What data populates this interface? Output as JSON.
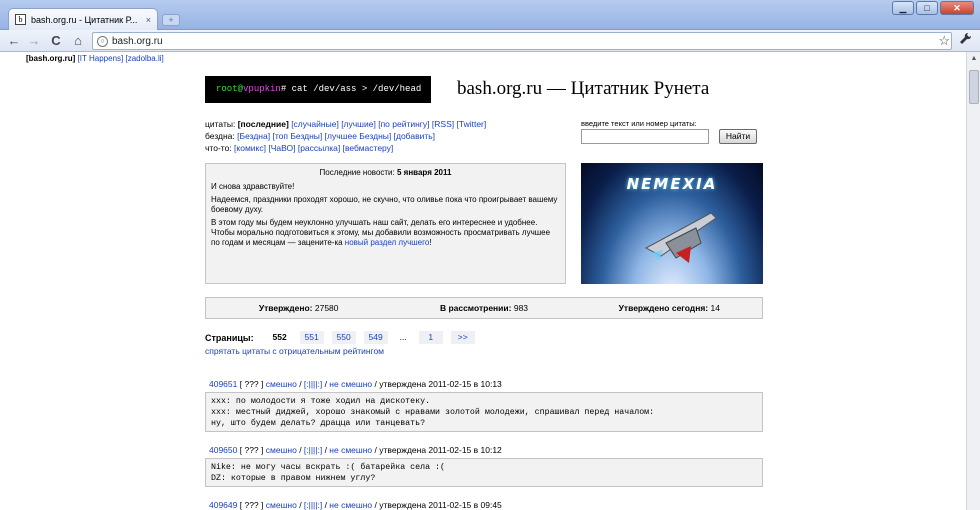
{
  "browser": {
    "tab_title": "bash.org.ru - Цитатник Р...",
    "tab_close": "×",
    "new_tab": "+",
    "url": "bash.org.ru",
    "win_min": "▁",
    "win_max": "□",
    "win_close": "✕",
    "back": "←",
    "forward": "→",
    "reload": "C",
    "home": "⌂",
    "star": "☆",
    "wrench": "🔧"
  },
  "bookmarks": {
    "current": "[bash.org.ru]",
    "it_happens": "[IT Happens]",
    "zadolba": "[zadolba.li]"
  },
  "header": {
    "prompt_user": "root",
    "prompt_at": "@",
    "prompt_host": "vpupkin",
    "prompt_cmd": "# cat /dev/ass > /dev/head",
    "site_title": "bash.org.ru — Цитатник Рунета"
  },
  "nav": {
    "quotes_label": "цитаты:",
    "quotes_current": "[последние]",
    "quotes_links": [
      "[случайные]",
      "[лучшие]",
      "[по рейтингу]",
      "[RSS]",
      "[Twitter]"
    ],
    "abyss_label": "бездна:",
    "abyss_links": [
      "[Бездна]",
      "[топ Бездны]",
      "[лучшее Бездны]",
      "[добавить]"
    ],
    "other_label": "что-то:",
    "other_links": [
      "[комикс]",
      "[ЧаВО]",
      "[рассылка]",
      "[вебмастеру]"
    ]
  },
  "search": {
    "label": "введите текст или номер цитаты:",
    "value": "",
    "button": "Найти"
  },
  "news": {
    "heading_prefix": "Последние новости:",
    "heading_date": "5 января 2011",
    "p1": "И снова здравствуйте!",
    "p2": "Надеемся, праздники проходят хорошо, не скучно, что оливье пока что проигрывает вашему боевому духу.",
    "p3": "В этом году мы будем неуклонно улучшать наш сайт, делать его интереснее и удобнее. Чтобы морально подготовиться к этому, мы добавили возможность просматривать лучшее по годам и месяцам — зацените-ка ",
    "p3_link": "новый раздел лучшего",
    "p3_end": "!"
  },
  "banner": {
    "title": "NEMEXIA"
  },
  "stats": {
    "approved_label": "Утверждено:",
    "approved_value": "27580",
    "review_label": "В рассмотрении:",
    "review_value": "983",
    "today_label": "Утверждено сегодня:",
    "today_value": "14"
  },
  "pager": {
    "label": "Страницы:",
    "current": "552",
    "pages": [
      "551",
      "550",
      "549"
    ],
    "dots": "...",
    "first": "1",
    "next": ">>",
    "hide_negative": "спрятать цитаты с отрицательным рейтингом"
  },
  "quotes": [
    {
      "id": "409651",
      "rating": "[ ??? ]",
      "funny": "смешно",
      "bayan": "[:||||:]",
      "not_funny": "не смешно",
      "approved": "/ утверждена 2011-02-15 в 10:13",
      "text": "xxx: по молодости я тоже ходил на дискотеку.\nxxx: местный диджей, хорошо знакомый с нравами золотой молодежи, спрашивал перед началом:\nну, што будем делать? драцца или танцевать?"
    },
    {
      "id": "409650",
      "rating": "[ ??? ]",
      "funny": "смешно",
      "bayan": "[:||||:]",
      "not_funny": "не смешно",
      "approved": "/ утверждена 2011-02-15 в 10:12",
      "text": "Nike: не могу часы вскрать :( батарейка села :(\nDZ: которые в правом нижнем углу?"
    },
    {
      "id": "409649",
      "rating": "[ ??? ]",
      "funny": "смешно",
      "bayan": "[:||||:]",
      "not_funny": "не смешно",
      "approved": "/ утверждена 2011-02-15 в 09:45",
      "text": ""
    }
  ]
}
